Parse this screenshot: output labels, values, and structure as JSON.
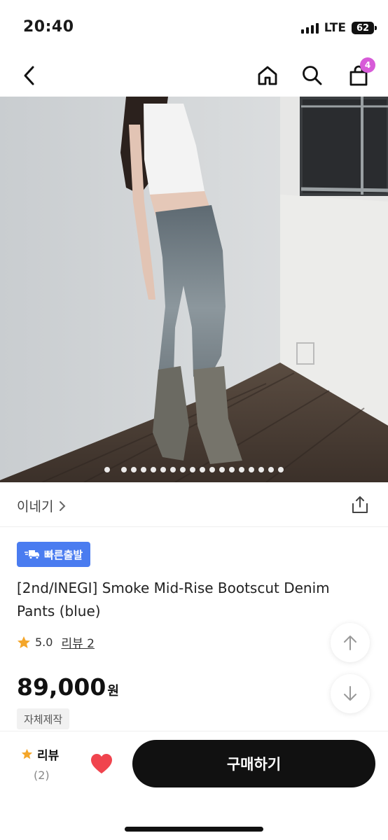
{
  "status_bar": {
    "time": "20:40",
    "network": "LTE",
    "battery": "62"
  },
  "nav": {
    "back_icon": "chevron-left-icon",
    "home_icon": "home-icon",
    "search_icon": "search-icon",
    "cart_icon": "shopping-bag-icon",
    "cart_count": "4",
    "cart_badge_color": "#d75bd8"
  },
  "hero": {
    "total_images": 18,
    "current_image": 1
  },
  "seller": {
    "name": "이네기",
    "chevron": "›",
    "share_icon": "share-icon"
  },
  "product": {
    "badge_label": "빠른출발",
    "badge_icon": "fast-truck-icon",
    "badge_color": "#4a7cf0",
    "title": "[2nd/INEGI] Smoke Mid-Rise Bootscut Denim Pants (blue)",
    "rating": "5.0",
    "review_link": "리뷰 2",
    "price": "89,000",
    "currency": "원",
    "tag": "자체제작"
  },
  "scroll_buttons": {
    "up_icon": "arrow-up-icon",
    "down_icon": "arrow-down-icon"
  },
  "bottom_bar": {
    "review_label": "리뷰",
    "review_count": "(2)",
    "heart_icon": "heart-icon",
    "heart_color": "#f0444e",
    "buy_label": "구매하기"
  }
}
